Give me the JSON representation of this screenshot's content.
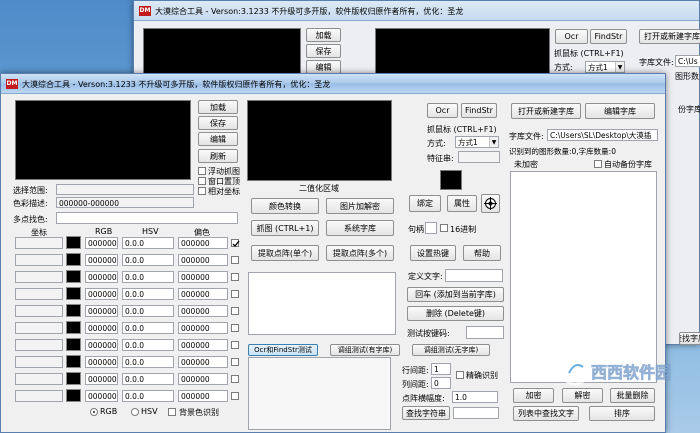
{
  "app_title": "大漠综合工具 - Verson:3.1233 不升级可多开版，软件版权归原作者所有，优化：圣龙",
  "back_window": {
    "title": "大漠综合工具 - Verson:3.1233 不升级可多开版，软件版权归原作者所有，优化：圣龙",
    "buttons": {
      "load": "加载",
      "save": "保存",
      "edit": "编辑",
      "ocr": "Ocr",
      "findstr": "FindStr",
      "open_lib": "打开或新建字库"
    },
    "capture_hotkey": "抓鼠标 (CTRL+F1)",
    "mode_label": "方式:",
    "mode_value": "方式1",
    "lib_file_label": "字库文件:",
    "lib_file_value": "C:\\Us",
    "right_fragments": {
      "shape_lib": "图形数",
      "backup": "份字库",
      "check_lib": "查找字库"
    }
  },
  "left": {
    "buttons": {
      "load": "加载",
      "save": "保存",
      "edit": "编辑",
      "refresh": "刷新"
    },
    "checkboxes": {
      "float_capture": "浮动抓图",
      "window_crop": "窗口置顶",
      "relative_coord": "相对坐标"
    },
    "select_range_label": "选择范围:",
    "color_desc_label": "色彩描述:",
    "color_desc_value": "000000-000000",
    "multi_point_label": "多点找色:",
    "headers": {
      "coord": "坐标",
      "rgb": "RGB",
      "hsv": "HSV",
      "offset": "偏色"
    },
    "rows": [
      {
        "rgb": "000000",
        "hsv": "0.0.0",
        "offset": "000000"
      },
      {
        "rgb": "000000",
        "hsv": "0.0.0",
        "offset": "000000"
      },
      {
        "rgb": "000000",
        "hsv": "0.0.0",
        "offset": "000000"
      },
      {
        "rgb": "000000",
        "hsv": "0.0.0",
        "offset": "000000"
      },
      {
        "rgb": "000000",
        "hsv": "0.0.0",
        "offset": "000000"
      },
      {
        "rgb": "000000",
        "hsv": "0.0.0",
        "offset": "000000"
      },
      {
        "rgb": "000000",
        "hsv": "0.0.0",
        "offset": "000000"
      },
      {
        "rgb": "000000",
        "hsv": "0.0.0",
        "offset": "000000"
      },
      {
        "rgb": "000000",
        "hsv": "0.0.0",
        "offset": "000000"
      },
      {
        "rgb": "000000",
        "hsv": "0.0.0",
        "offset": "000000"
      }
    ],
    "row_checked": [
      true,
      false,
      false,
      false,
      false,
      false,
      false,
      false,
      false,
      false
    ],
    "radio_rgb": "RGB",
    "radio_hsv": "HSV",
    "bg_color_recognize": "背景色识别"
  },
  "middle": {
    "binary_area_label": "二值化区域",
    "buttons": {
      "color_convert": "颜色转换",
      "image_decrypt": "图片加解密",
      "capture": "抓图 (CTRL+1)",
      "system_lib": "系统字库",
      "extract_single": "提取点阵(单个)",
      "extract_multi": "提取点阵(多个)"
    },
    "tabs": [
      "Ocr和FindStr测试",
      "调组测试(有字库)",
      "调组测试(无字库)"
    ]
  },
  "center": {
    "ocr": "Ocr",
    "findstr": "FindStr",
    "capture_hotkey": "抓鼠标 (CTRL+F1)",
    "mode_label": "方式:",
    "mode_value": "方式1",
    "feature_label": "特征串:",
    "bind": "绑定",
    "attr": "属性",
    "jump_label": "句柄",
    "hex_label": "16进制",
    "set_hotkey": "设置热键",
    "help": "帮助",
    "define_text": "定义文字:",
    "add_to_lib": "回车 (添加到当前字库)",
    "delete": "删除 (Delete键)",
    "test_key": "测试按键码:",
    "row_gap_label": "行间距:",
    "row_gap_value": "1",
    "col_gap_label": "列间距:",
    "col_gap_value": "0",
    "lattice_label": "点阵横幅度:",
    "lattice_value": "1.0",
    "find_string": "查找字符串",
    "accurate": "精确识别"
  },
  "right": {
    "open_lib": "打开或新建字库",
    "edit_lib": "编辑字库",
    "lib_file_label": "字库文件:",
    "lib_file_value": "C:\\Users\\SL\\Desktop\\大漠插",
    "recognize_stats": "识别到的图形数量:0,字库数量:0",
    "not_encrypted": "未加密",
    "auto_backup": "自动备份字库",
    "encrypt": "加密",
    "decrypt": "解密",
    "batch_delete": "批量删除",
    "list_find": "列表中查找文字",
    "sort": "排序"
  },
  "watermark_text": "西西软件园"
}
